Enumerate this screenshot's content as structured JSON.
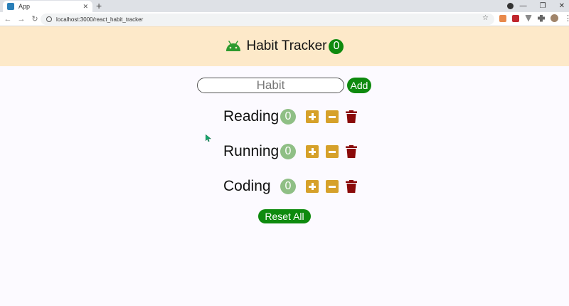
{
  "browser": {
    "tab_title": "App",
    "tab_close": "✕",
    "new_tab": "+",
    "url": "localhost:3000/react_habit_tracker",
    "win_min": "—",
    "win_max": "❐",
    "win_close": "✕",
    "back": "←",
    "forward": "→",
    "reload": "↻",
    "star": "☆",
    "menu": "⋮"
  },
  "header": {
    "icon": "android-icon",
    "title": "Habit Tracker",
    "total_count": "0",
    "colors": {
      "background": "#fde9c9",
      "badge": "#0e8a0e"
    }
  },
  "form": {
    "placeholder": "Habit",
    "add_label": "Add"
  },
  "habits": [
    {
      "name": "Reading",
      "count": "0"
    },
    {
      "name": "Running",
      "count": "0"
    },
    {
      "name": "Coding",
      "count": "0"
    }
  ],
  "icons": {
    "increase": "plus-square-icon",
    "decrease": "minus-square-icon",
    "delete": "trash-icon"
  },
  "colors": {
    "action_button": "#d6a12a",
    "delete": "#8b0a0a",
    "count_badge": "#8fbf85",
    "primary": "#0e8a0e"
  },
  "reset_label": "Reset All"
}
